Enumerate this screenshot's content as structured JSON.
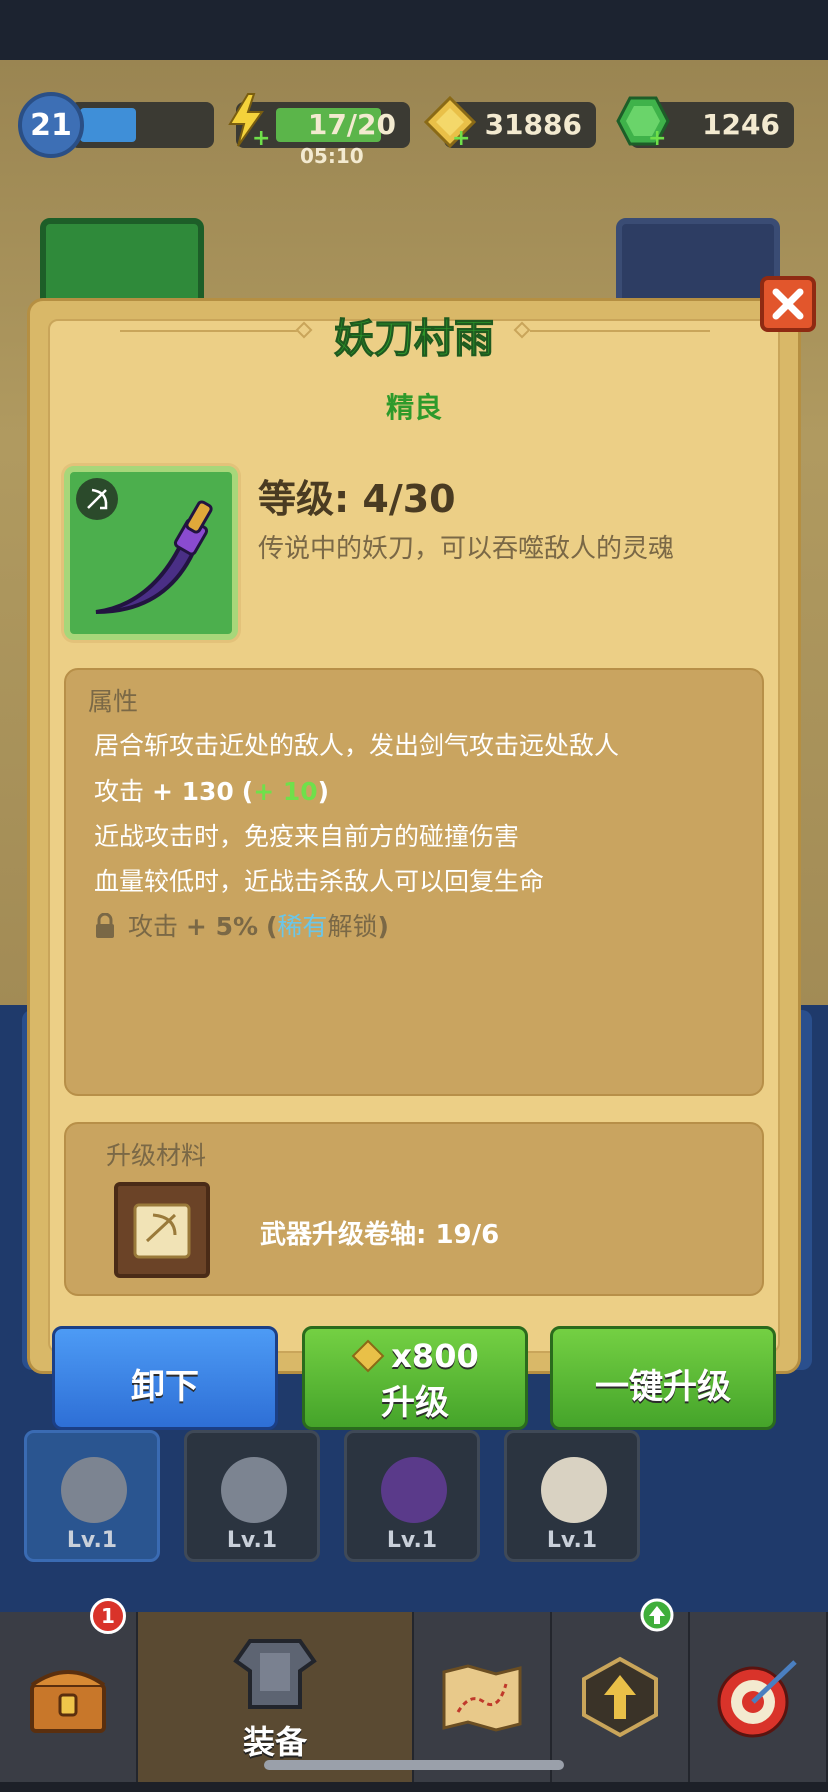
{
  "top_bar": {
    "player_level": "21",
    "energy": "17/20",
    "energy_timer": "05:10",
    "energy_fill": 0.85,
    "xp_fill": 0.45,
    "gold": "31886",
    "gems": "1246"
  },
  "modal": {
    "title": "妖刀村雨",
    "rarity": "精良",
    "level_text": "等级: 4/30",
    "description": "传说中的妖刀，可以吞噬敌人的灵魂",
    "attributes": {
      "header": "属性",
      "line1": "居合斩攻击近处的敌人，发出剑气攻击远处敌人",
      "attack_label": "攻击",
      "attack_value": "+ 130",
      "attack_bonus": "+ 10",
      "line3": "近战攻击时，免疫来自前方的碰撞伤害",
      "line4": "血量较低时，近战击杀敌人可以回复生命",
      "locked_label": "攻击",
      "locked_value": "+ 5%",
      "locked_quality": "稀有",
      "locked_suffix": "解锁"
    },
    "materials": {
      "header": "升级材料",
      "item_text": "武器升级卷轴: 19/6"
    },
    "buttons": {
      "unequip": "卸下",
      "upgrade_cost": "x800",
      "upgrade": "升级",
      "one_click_upgrade": "一键升级"
    }
  },
  "pets": [
    {
      "level": "Lv.1",
      "icon": "lion-ring-icon"
    },
    {
      "level": "Lv.1",
      "icon": "panther-ring-icon"
    },
    {
      "level": "Lv.1",
      "icon": "reaper-pet-icon"
    },
    {
      "level": "Lv.1",
      "icon": "owl-pet-icon"
    }
  ],
  "bottom_nav": {
    "shop_badge": "1",
    "equipment_label": "装备"
  },
  "colors": {
    "title_green": "#2e9a2b",
    "bonus_green": "#6fe04a",
    "rare_blue": "#6bc6e8",
    "button_blue": "#2e6fd6",
    "button_green": "#45a42a"
  }
}
